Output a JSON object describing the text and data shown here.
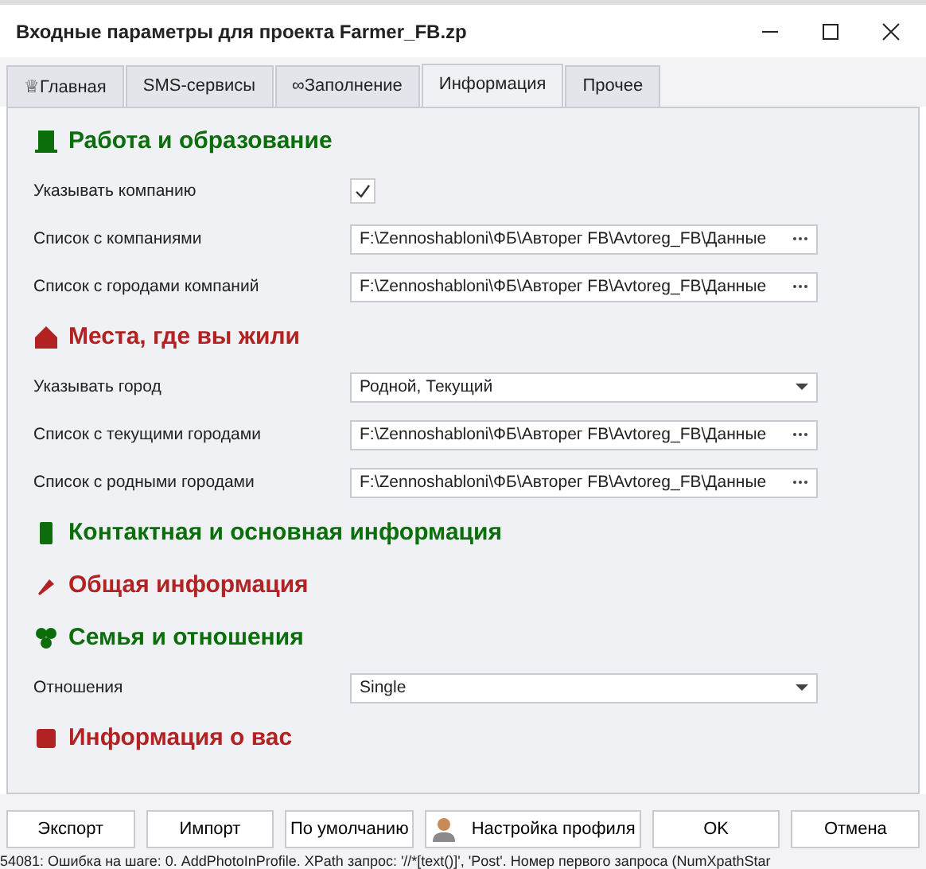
{
  "window": {
    "title": "Входные параметры для проекта Farmer_FB.zp"
  },
  "tabs": [
    {
      "label": "Главная",
      "icon": "♕",
      "selected": false
    },
    {
      "label": "SMS-сервисы",
      "selected": false
    },
    {
      "label": "Заполнение",
      "icon": "∞",
      "selected": false
    },
    {
      "label": "Информация",
      "selected": true
    },
    {
      "label": "Прочее",
      "selected": false
    }
  ],
  "sections": [
    {
      "title": "Работа и образование",
      "color": "#0b6e0b",
      "fields": [
        {
          "kind": "checkbox",
          "label": "Указывать компанию",
          "checked": true
        },
        {
          "kind": "file",
          "label": "Список с компаниями",
          "value": "F:\\Zennoshabloni\\ФБ\\Авторег FB\\Avtoreg_FB\\Данные"
        },
        {
          "kind": "file",
          "label": "Список с городами компаний",
          "value": "F:\\Zennoshabloni\\ФБ\\Авторег FB\\Avtoreg_FB\\Данные"
        }
      ]
    },
    {
      "title": "Места, где вы жили",
      "color": "#b22222",
      "fields": [
        {
          "kind": "dropdown",
          "label": "Указывать город",
          "value": "Родной, Текущий"
        },
        {
          "kind": "file",
          "label": "Список с текущими городами",
          "value": "F:\\Zennoshabloni\\ФБ\\Авторег FB\\Avtoreg_FB\\Данные"
        },
        {
          "kind": "file",
          "label": "Список с родными городами",
          "value": "F:\\Zennoshabloni\\ФБ\\Авторег FB\\Avtoreg_FB\\Данные"
        }
      ]
    },
    {
      "title": "Контактная и основная информация",
      "color": "#0b6e0b"
    },
    {
      "title": "Общая информация",
      "color": "#b22222"
    },
    {
      "title": "Семья и отношения",
      "color": "#0b6e0b",
      "fields": [
        {
          "kind": "dropdown",
          "label": "Отношения",
          "value": "Single"
        }
      ]
    },
    {
      "title": "Информация о вас",
      "color": "#b22222"
    }
  ],
  "buttons": [
    {
      "label": "Экспорт",
      "kind": "plain"
    },
    {
      "label": "Импорт",
      "kind": "plain"
    },
    {
      "label": "По умолчанию",
      "kind": "plain"
    },
    {
      "label": "Настройка профиля",
      "kind": "profile"
    },
    {
      "label": "OK",
      "kind": "plain"
    },
    {
      "label": "Отмена",
      "kind": "plain"
    }
  ],
  "log_line": "54081: Ошибка на шаге: 0. AddPhotoInProfile. XPath запрос: '//*[text()]', 'Post'. Номер первого запроса (NumXpathStar"
}
